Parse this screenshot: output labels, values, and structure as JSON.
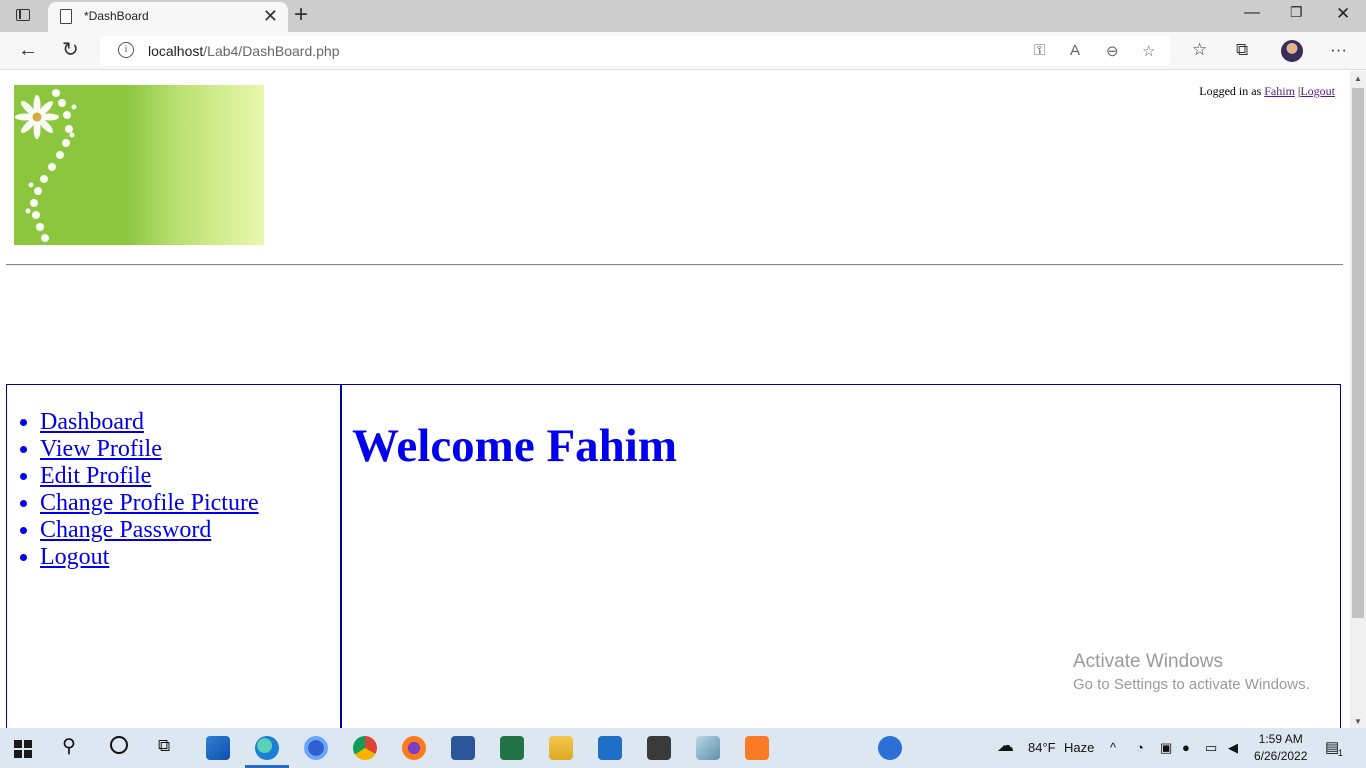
{
  "browser": {
    "tab_title": "*DashBoard",
    "url_host": "localhost",
    "url_path": "/Lab4/DashBoard.php"
  },
  "header": {
    "logged_in_prefix": "Logged in as",
    "username": "Fahim",
    "separator": "|",
    "logout_link": "Logout"
  },
  "sidebar": {
    "items": [
      {
        "label": "Dashboard"
      },
      {
        "label": "View Profile"
      },
      {
        "label": "Edit Profile"
      },
      {
        "label": "Change Profile Picture"
      },
      {
        "label": "Change Password"
      },
      {
        "label": "Logout"
      }
    ]
  },
  "content": {
    "welcome": "Welcome Fahim"
  },
  "watermark": {
    "title": "Activate Windows",
    "subtitle": "Go to Settings to activate Windows."
  },
  "taskbar": {
    "weather_temp": "84°F",
    "weather_text": "Haze",
    "time": "1:59 AM",
    "date": "6/26/2022",
    "notification_count": "1"
  },
  "colors": {
    "link": "#0000ee",
    "visited": "#551a8b",
    "border": "#0000aa"
  }
}
